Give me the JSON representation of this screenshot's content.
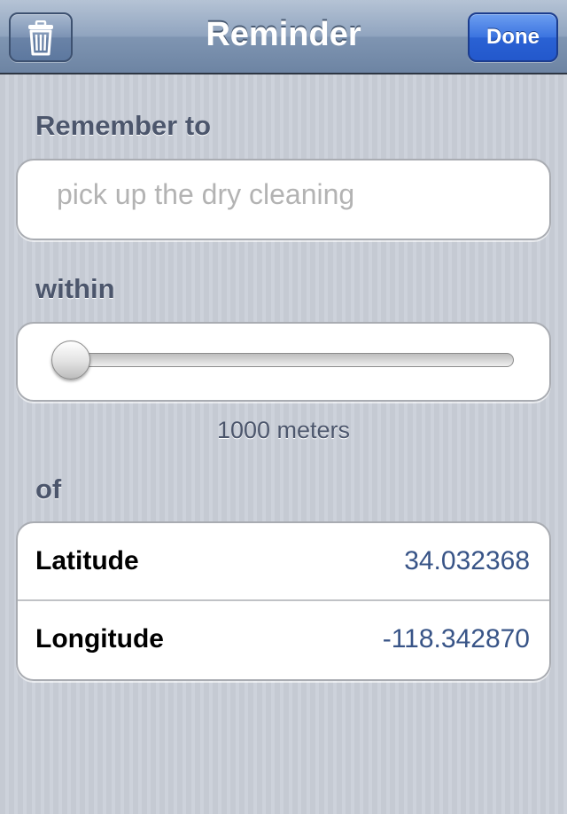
{
  "navbar": {
    "title": "Reminder",
    "trash_icon": "trash-icon",
    "done_label": "Done"
  },
  "form": {
    "remember_label": "Remember to",
    "reminder_placeholder": "pick up the dry cleaning",
    "reminder_value": "",
    "within_label": "within",
    "slider_fraction": 0.0,
    "distance_text": "1000 meters",
    "of_label": "of"
  },
  "location": {
    "rows": [
      {
        "label": "Latitude",
        "value": "34.032368"
      },
      {
        "label": "Longitude",
        "value": "-118.342870"
      }
    ]
  },
  "colors": {
    "nav_bar": "#7f95b2",
    "done_button": "#2a62d4",
    "value_text": "#385487",
    "label_text": "#4c566c"
  }
}
